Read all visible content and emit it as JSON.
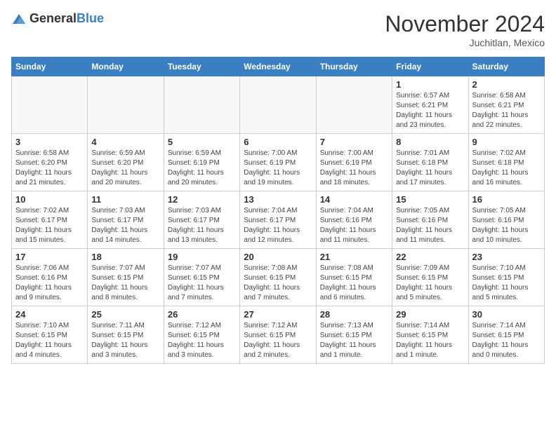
{
  "logo": {
    "general": "General",
    "blue": "Blue"
  },
  "header": {
    "month_title": "November 2024",
    "location": "Juchitlan, Mexico"
  },
  "weekdays": [
    "Sunday",
    "Monday",
    "Tuesday",
    "Wednesday",
    "Thursday",
    "Friday",
    "Saturday"
  ],
  "weeks": [
    [
      {
        "day": "",
        "detail": ""
      },
      {
        "day": "",
        "detail": ""
      },
      {
        "day": "",
        "detail": ""
      },
      {
        "day": "",
        "detail": ""
      },
      {
        "day": "",
        "detail": ""
      },
      {
        "day": "1",
        "detail": "Sunrise: 6:57 AM\nSunset: 6:21 PM\nDaylight: 11 hours and 23 minutes."
      },
      {
        "day": "2",
        "detail": "Sunrise: 6:58 AM\nSunset: 6:21 PM\nDaylight: 11 hours and 22 minutes."
      }
    ],
    [
      {
        "day": "3",
        "detail": "Sunrise: 6:58 AM\nSunset: 6:20 PM\nDaylight: 11 hours and 21 minutes."
      },
      {
        "day": "4",
        "detail": "Sunrise: 6:59 AM\nSunset: 6:20 PM\nDaylight: 11 hours and 20 minutes."
      },
      {
        "day": "5",
        "detail": "Sunrise: 6:59 AM\nSunset: 6:19 PM\nDaylight: 11 hours and 20 minutes."
      },
      {
        "day": "6",
        "detail": "Sunrise: 7:00 AM\nSunset: 6:19 PM\nDaylight: 11 hours and 19 minutes."
      },
      {
        "day": "7",
        "detail": "Sunrise: 7:00 AM\nSunset: 6:19 PM\nDaylight: 11 hours and 18 minutes."
      },
      {
        "day": "8",
        "detail": "Sunrise: 7:01 AM\nSunset: 6:18 PM\nDaylight: 11 hours and 17 minutes."
      },
      {
        "day": "9",
        "detail": "Sunrise: 7:02 AM\nSunset: 6:18 PM\nDaylight: 11 hours and 16 minutes."
      }
    ],
    [
      {
        "day": "10",
        "detail": "Sunrise: 7:02 AM\nSunset: 6:17 PM\nDaylight: 11 hours and 15 minutes."
      },
      {
        "day": "11",
        "detail": "Sunrise: 7:03 AM\nSunset: 6:17 PM\nDaylight: 11 hours and 14 minutes."
      },
      {
        "day": "12",
        "detail": "Sunrise: 7:03 AM\nSunset: 6:17 PM\nDaylight: 11 hours and 13 minutes."
      },
      {
        "day": "13",
        "detail": "Sunrise: 7:04 AM\nSunset: 6:17 PM\nDaylight: 11 hours and 12 minutes."
      },
      {
        "day": "14",
        "detail": "Sunrise: 7:04 AM\nSunset: 6:16 PM\nDaylight: 11 hours and 11 minutes."
      },
      {
        "day": "15",
        "detail": "Sunrise: 7:05 AM\nSunset: 6:16 PM\nDaylight: 11 hours and 11 minutes."
      },
      {
        "day": "16",
        "detail": "Sunrise: 7:05 AM\nSunset: 6:16 PM\nDaylight: 11 hours and 10 minutes."
      }
    ],
    [
      {
        "day": "17",
        "detail": "Sunrise: 7:06 AM\nSunset: 6:16 PM\nDaylight: 11 hours and 9 minutes."
      },
      {
        "day": "18",
        "detail": "Sunrise: 7:07 AM\nSunset: 6:15 PM\nDaylight: 11 hours and 8 minutes."
      },
      {
        "day": "19",
        "detail": "Sunrise: 7:07 AM\nSunset: 6:15 PM\nDaylight: 11 hours and 7 minutes."
      },
      {
        "day": "20",
        "detail": "Sunrise: 7:08 AM\nSunset: 6:15 PM\nDaylight: 11 hours and 7 minutes."
      },
      {
        "day": "21",
        "detail": "Sunrise: 7:08 AM\nSunset: 6:15 PM\nDaylight: 11 hours and 6 minutes."
      },
      {
        "day": "22",
        "detail": "Sunrise: 7:09 AM\nSunset: 6:15 PM\nDaylight: 11 hours and 5 minutes."
      },
      {
        "day": "23",
        "detail": "Sunrise: 7:10 AM\nSunset: 6:15 PM\nDaylight: 11 hours and 5 minutes."
      }
    ],
    [
      {
        "day": "24",
        "detail": "Sunrise: 7:10 AM\nSunset: 6:15 PM\nDaylight: 11 hours and 4 minutes."
      },
      {
        "day": "25",
        "detail": "Sunrise: 7:11 AM\nSunset: 6:15 PM\nDaylight: 11 hours and 3 minutes."
      },
      {
        "day": "26",
        "detail": "Sunrise: 7:12 AM\nSunset: 6:15 PM\nDaylight: 11 hours and 3 minutes."
      },
      {
        "day": "27",
        "detail": "Sunrise: 7:12 AM\nSunset: 6:15 PM\nDaylight: 11 hours and 2 minutes."
      },
      {
        "day": "28",
        "detail": "Sunrise: 7:13 AM\nSunset: 6:15 PM\nDaylight: 11 hours and 1 minute."
      },
      {
        "day": "29",
        "detail": "Sunrise: 7:14 AM\nSunset: 6:15 PM\nDaylight: 11 hours and 1 minute."
      },
      {
        "day": "30",
        "detail": "Sunrise: 7:14 AM\nSunset: 6:15 PM\nDaylight: 11 hours and 0 minutes."
      }
    ]
  ]
}
